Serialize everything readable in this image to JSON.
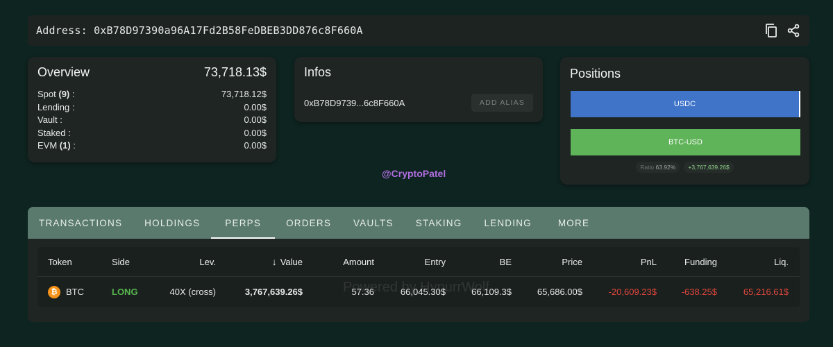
{
  "address_bar": {
    "text": "Address: 0xB78D97390a96A17Fd2B58FeDBEB3DD876c8F660A",
    "copy_icon": "copy-icon",
    "share_icon": "share-icon"
  },
  "overview": {
    "title": "Overview",
    "total": "73,718.13$",
    "rows": [
      {
        "label": "Spot",
        "count": "(9)",
        "suffix": " :",
        "value": "73,718.12$"
      },
      {
        "label": "Lending :",
        "count": "",
        "suffix": "",
        "value": "0.00$"
      },
      {
        "label": "Vault :",
        "count": "",
        "suffix": "",
        "value": "0.00$"
      },
      {
        "label": "Staked :",
        "count": "",
        "suffix": "",
        "value": "0.00$"
      },
      {
        "label": "EVM",
        "count": "(1)",
        "suffix": " :",
        "value": "0.00$"
      }
    ]
  },
  "infos": {
    "title": "Infos",
    "short_address": "0xB78D9739...6c8F660A",
    "alias_button": "ADD ALIAS"
  },
  "positions": {
    "title": "Positions",
    "bars": [
      {
        "label": "USDC",
        "color": "#3f74c9"
      },
      {
        "label": "BTC-USD",
        "color": "#5fb358"
      }
    ],
    "ratio_label": "Ratio",
    "ratio_value": "63.92%",
    "pnl_tag": "+3,767,639.26$"
  },
  "watermark": "@CryptoPatel",
  "tabs": [
    "TRANSACTIONS",
    "HOLDINGS",
    "PERPS",
    "ORDERS",
    "VAULTS",
    "STAKING",
    "LENDING",
    "MORE"
  ],
  "active_tab": "PERPS",
  "table": {
    "columns": [
      "Token",
      "Side",
      "Lev.",
      "Value",
      "Amount",
      "Entry",
      "BE",
      "Price",
      "PnL",
      "Funding",
      "Liq."
    ],
    "sort_icon": "arrow-down-icon",
    "rows": [
      {
        "token": "BTC",
        "side": "LONG",
        "lev": "40X (cross)",
        "value": "3,767,639.26$",
        "amount": "57.36",
        "entry": "66,045.30$",
        "be": "66,109.3$",
        "price": "65,686.00$",
        "pnl": "-20,609.23$",
        "funding": "-638.25$",
        "liq": "65,216.61$"
      }
    ],
    "powered_by": "Powered by HypurrWolf"
  },
  "colors": {
    "background": "#0e2420",
    "card": "#1f2523",
    "tab_bar": "#5a7a6e",
    "long": "#58b84f",
    "negative": "#e2463d",
    "btc": "#f7931a"
  }
}
